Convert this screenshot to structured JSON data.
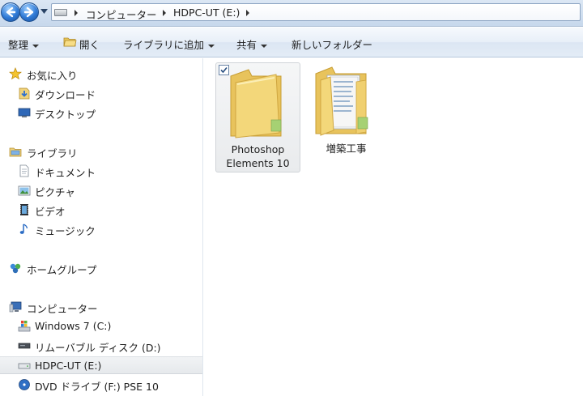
{
  "address": {
    "crumbs": [
      "コンピューター",
      "HDPC-UT (E:)"
    ]
  },
  "toolbar": {
    "organize": "整理",
    "open": "開く",
    "add_to_library": "ライブラリに追加",
    "share": "共有",
    "new_folder": "新しいフォルダー"
  },
  "nav": {
    "favorites": {
      "label": "お気に入り",
      "items": [
        "ダウンロード",
        "デスクトップ"
      ]
    },
    "libraries": {
      "label": "ライブラリ",
      "items": [
        "ドキュメント",
        "ピクチャ",
        "ビデオ",
        "ミュージック"
      ]
    },
    "homegroup": {
      "label": "ホームグループ"
    },
    "computer": {
      "label": "コンピューター",
      "items": [
        "Windows 7 (C:)",
        "リムーバブル ディスク (D:)",
        "HDPC-UT (E:)",
        "DVD ドライブ (F:) PSE 10"
      ]
    }
  },
  "files": [
    {
      "name_line1": "Photoshop",
      "name_line2": "Elements 10",
      "selected": true
    },
    {
      "name_line1": "増築工事",
      "name_line2": "",
      "selected": false
    }
  ],
  "colors": {
    "folder_yellow": "#f3d77a",
    "selection_gray": "#e9ebed",
    "toolbar_blue": "#dce6f3"
  }
}
